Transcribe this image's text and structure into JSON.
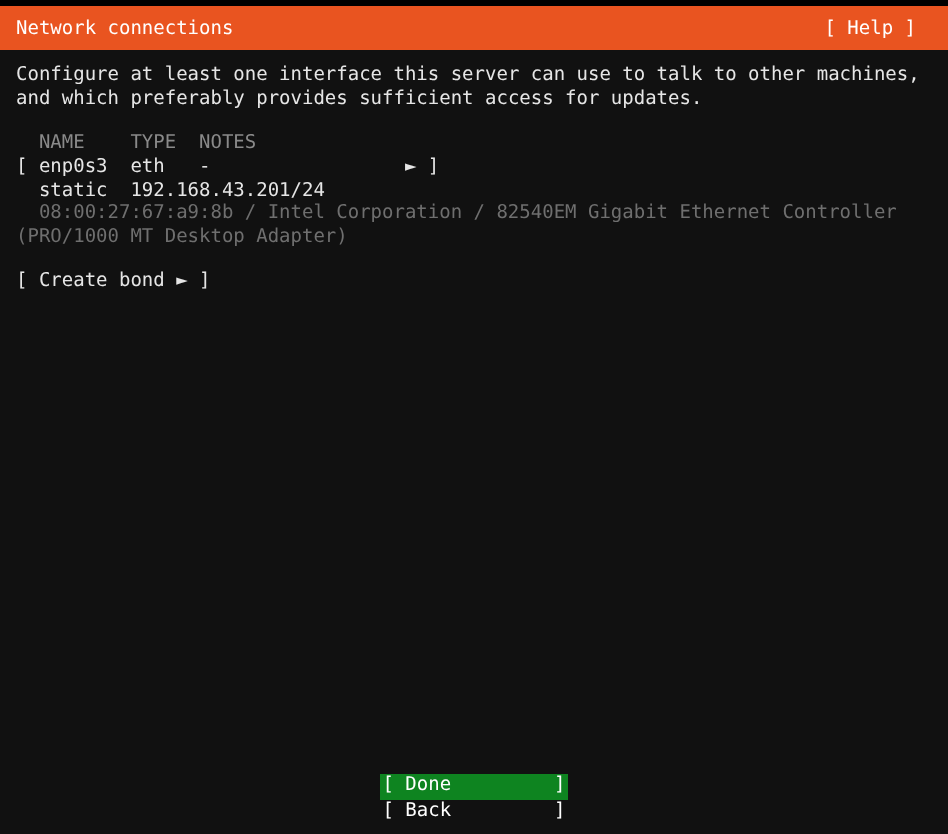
{
  "header": {
    "title": "Network connections",
    "help": "[ Help ]"
  },
  "description": "Configure at least one interface this server can use to talk to other machines,\nand which preferably provides sufficient access for updates.",
  "columns": [
    "NAME",
    "TYPE",
    "NOTES"
  ],
  "interfaces": [
    {
      "open": "[",
      "name": "enp0s3",
      "type": "eth",
      "notes": "-",
      "arrow": "►",
      "close": "]",
      "address_mode": "static",
      "address": "192.168.43.201/24",
      "hardware": "08:00:27:67:a9:8b / Intel Corporation / 82540EM Gigabit Ethernet Controller\n(PRO/1000 MT Desktop Adapter)"
    }
  ],
  "create_bond": "[ Create bond ► ]",
  "buttons": [
    {
      "label": "[ Done         ]",
      "selected": true
    },
    {
      "label": "[ Back         ]",
      "selected": false
    }
  ]
}
